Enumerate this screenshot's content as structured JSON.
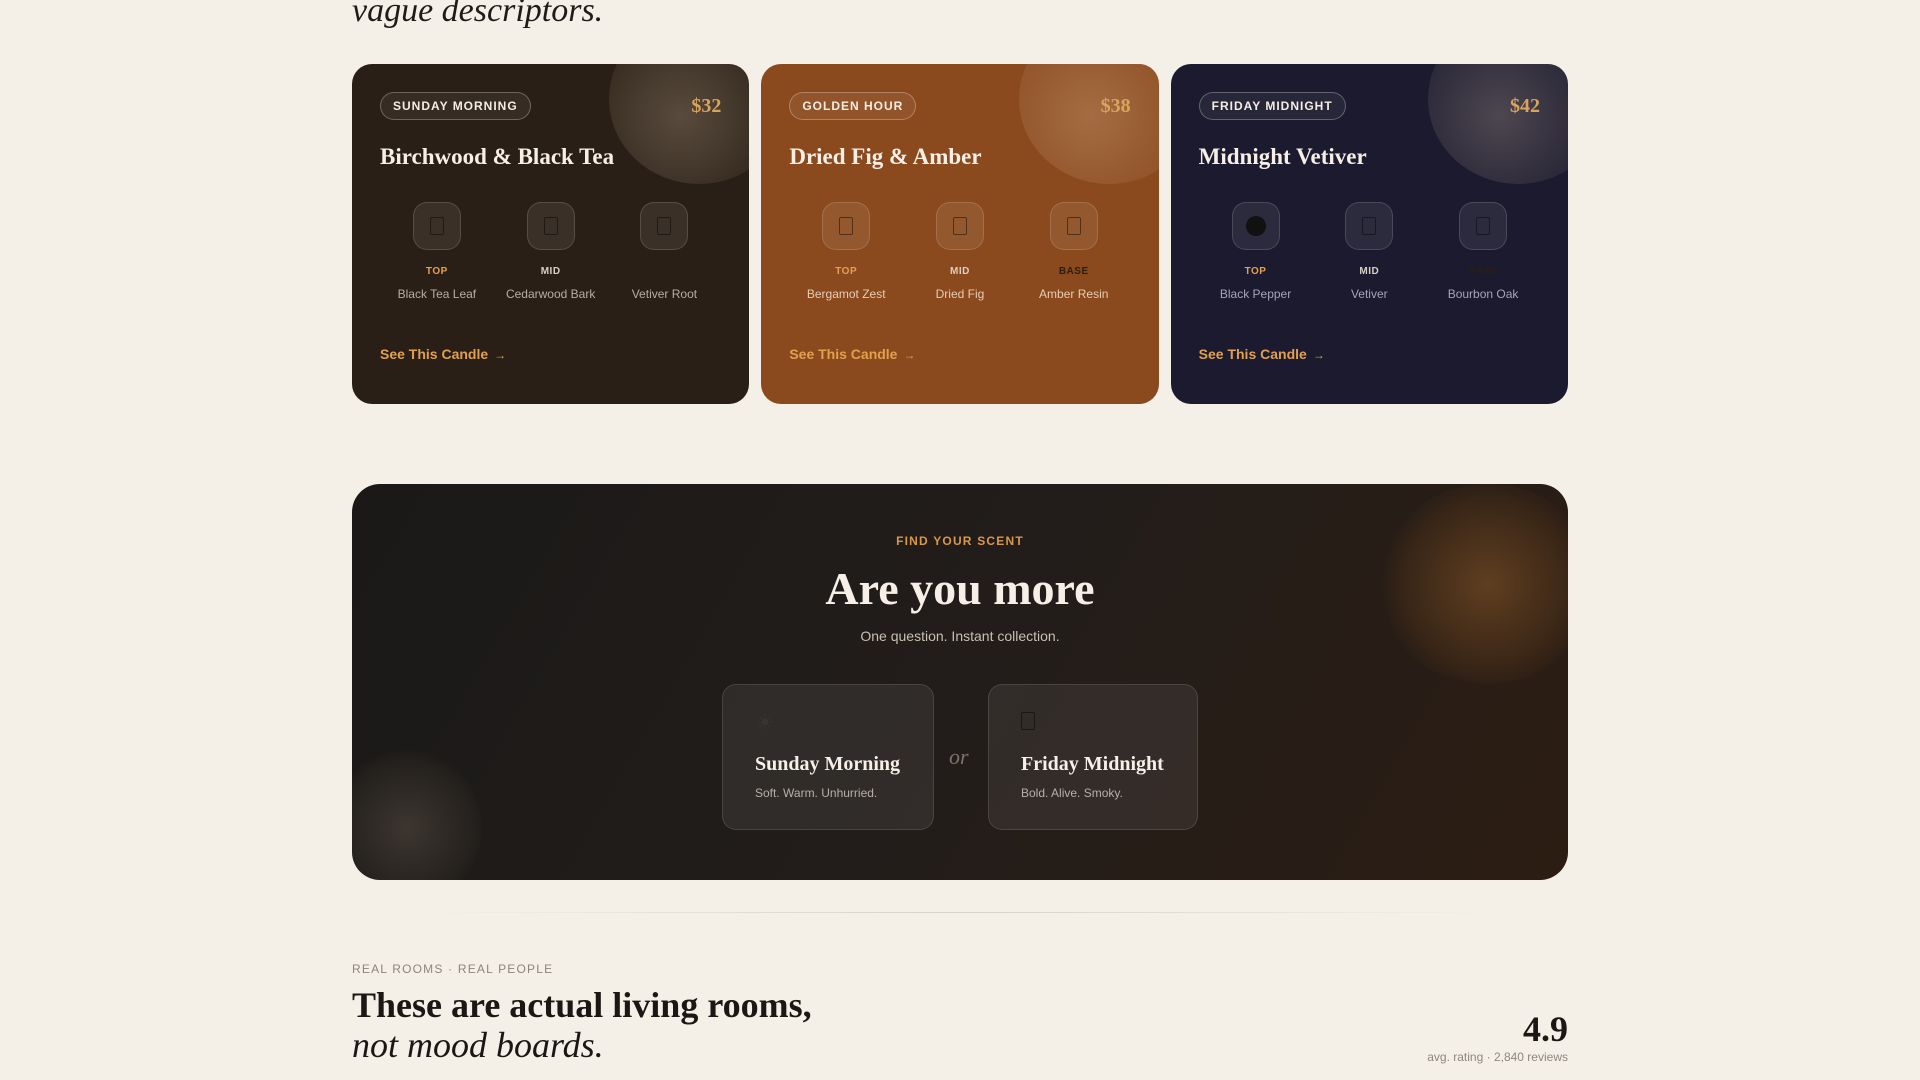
{
  "hero": {
    "tail": "vague descriptors."
  },
  "cards": [
    {
      "badge": "SUNDAY MORNING",
      "price": "$32",
      "title": "Birchwood & Black Tea",
      "notes": [
        {
          "level": "TOP",
          "name": "Black Tea Leaf"
        },
        {
          "level": "MID",
          "name": "Cedarwood Bark"
        },
        {
          "level": "BASE",
          "name": "Vetiver Root"
        }
      ],
      "cta": "See This Candle",
      "arrow": "→"
    },
    {
      "badge": "GOLDEN HOUR",
      "price": "$38",
      "title": "Dried Fig & Amber",
      "notes": [
        {
          "level": "TOP",
          "name": "Bergamot Zest"
        },
        {
          "level": "MID",
          "name": "Dried Fig"
        },
        {
          "level": "BASE",
          "name": "Amber Resin"
        }
      ],
      "cta": "See This Candle",
      "arrow": "→"
    },
    {
      "badge": "FRIDAY MIDNIGHT",
      "price": "$42",
      "title": "Midnight Vetiver",
      "notes": [
        {
          "level": "TOP",
          "name": "Black Pepper"
        },
        {
          "level": "MID",
          "name": "Vetiver"
        },
        {
          "level": "BASE",
          "name": "Bourbon Oak"
        }
      ],
      "cta": "See This Candle",
      "arrow": "→"
    }
  ],
  "quiz": {
    "eyebrow": "FIND YOUR SCENT",
    "title": "Are you more",
    "subtitle": "One question. Instant collection.",
    "or": "or",
    "options": [
      {
        "icon": "☀",
        "icon_name": "sun-icon",
        "title": "Sunday Morning",
        "desc": "Soft. Warm. Unhurried."
      },
      {
        "icon_name": "moon-icon",
        "title": "Friday Midnight",
        "desc": "Bold. Alive. Smoky."
      }
    ]
  },
  "rooms": {
    "eyebrow": "REAL ROOMS · REAL PEOPLE",
    "title": "These are actual living rooms,",
    "subtitle": "not mood boards.",
    "rating": "4.9",
    "rating_sub": "avg. rating · 2,840 reviews"
  },
  "colors": {
    "background": "#f4efe7",
    "card_sunday": "#2a1f16",
    "card_golden": "#8b4a1e",
    "card_midnight": "#1b1a2e",
    "accent": "#e1a04e"
  }
}
